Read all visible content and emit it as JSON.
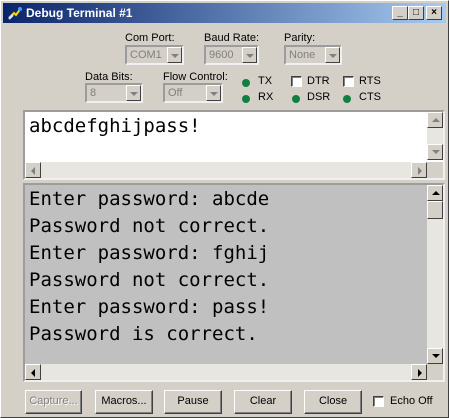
{
  "window": {
    "title": "Debug Terminal #1",
    "controls": {
      "minimize": "_",
      "maximize": "□",
      "close": "×"
    }
  },
  "settings": {
    "com_port": {
      "label": "Com Port:",
      "value": "COM1"
    },
    "baud_rate": {
      "label": "Baud Rate:",
      "value": "9600"
    },
    "parity": {
      "label": "Parity:",
      "value": "None"
    },
    "data_bits": {
      "label": "Data Bits:",
      "value": "8"
    },
    "flow_control": {
      "label": "Flow Control:",
      "value": "Off"
    }
  },
  "indicators": {
    "tx": "TX",
    "rx": "RX",
    "dsr": "DSR",
    "cts": "CTS",
    "led_color": "#108040"
  },
  "toggles": {
    "dtr": "DTR",
    "rts": "RTS"
  },
  "input_text": "abcdefghijpass!",
  "output_lines": [
    "Enter password: abcde",
    "Password not correct.",
    "Enter password: fghij",
    "Password not correct.",
    "Enter password: pass!",
    "Password is correct."
  ],
  "buttons": {
    "capture": "Capture...",
    "macros": "Macros...",
    "pause": "Pause",
    "clear": "Clear",
    "close": "Close",
    "echo_off": "Echo Off"
  }
}
